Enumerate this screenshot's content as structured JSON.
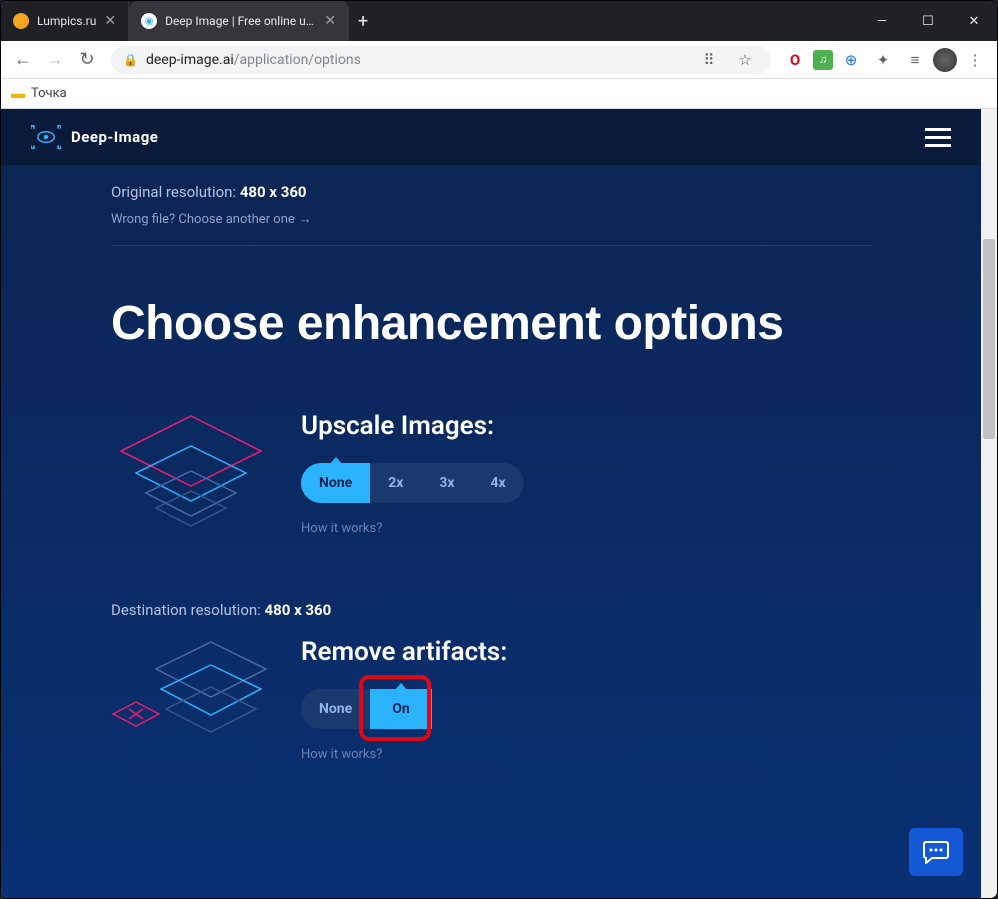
{
  "window": {
    "minimize": "—",
    "maximize": "☐",
    "close": "✕"
  },
  "tabs": [
    {
      "title": "Lumpics.ru",
      "active": false
    },
    {
      "title": "Deep Image | Free online upscale",
      "active": true
    }
  ],
  "newtab": "+",
  "nav": {
    "back": "←",
    "forward": "→",
    "reload": "↻"
  },
  "url": {
    "host": "deep-image.ai",
    "path": "/application/options",
    "lock": "🔒"
  },
  "toolbar_icons": {
    "translate": "⠿",
    "star": "☆",
    "opera": "O",
    "music": "♫",
    "globe": "⊕",
    "ext": "✦",
    "list": "≡",
    "menu": "⋮"
  },
  "bookmarks": {
    "folder": "▬",
    "tochka": "Точка"
  },
  "site": {
    "brand": "Deep-Image"
  },
  "origres": {
    "label": "Original resolution:",
    "value": "480 x 360"
  },
  "wrongfile": {
    "text": "Wrong file? Choose another one",
    "arrow": "→"
  },
  "title": "Choose enhancement options",
  "upscale": {
    "heading": "Upscale Images:",
    "buttons": [
      "None",
      "2x",
      "3x",
      "4x"
    ],
    "how": "How it works?"
  },
  "destres": {
    "label": "Destination resolution:",
    "value": "480 x 360"
  },
  "artifacts": {
    "heading": "Remove artifacts:",
    "buttons": [
      "None",
      "On"
    ],
    "how": "How it works?"
  }
}
